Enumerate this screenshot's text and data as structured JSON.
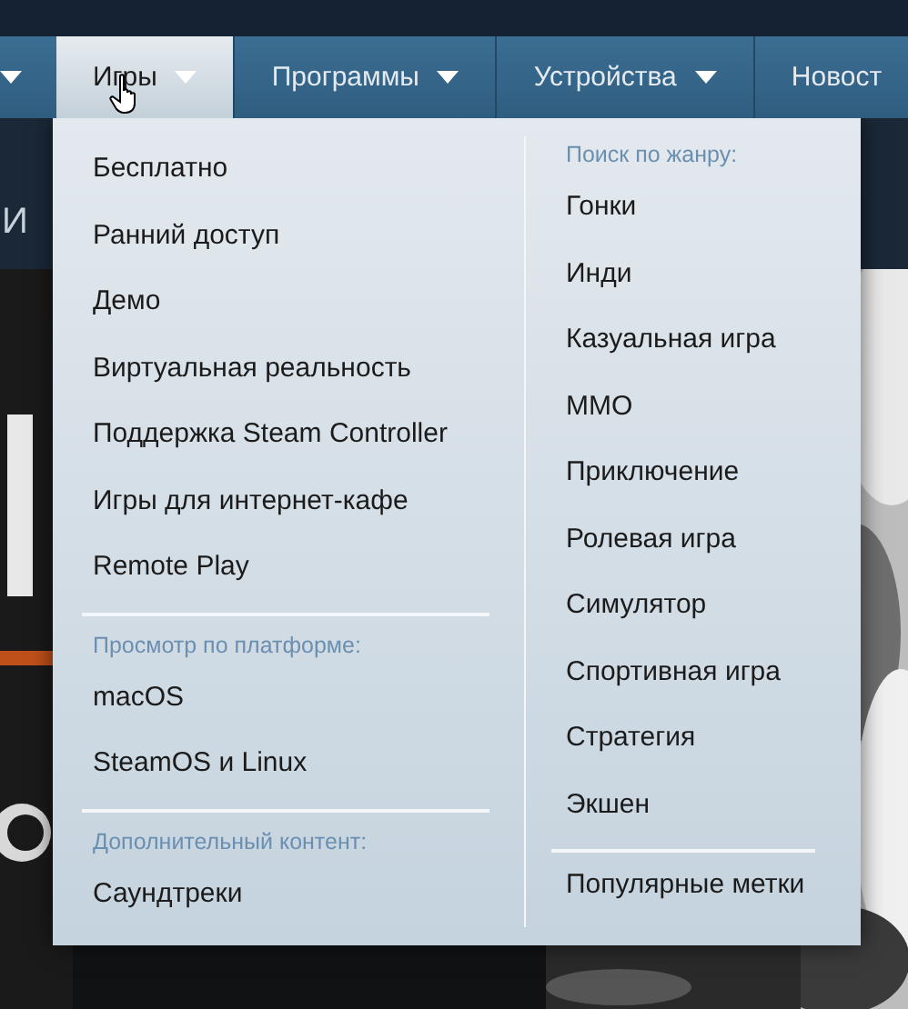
{
  "nav": {
    "items": [
      {
        "caret": true,
        "selected": false
      },
      {
        "label": "Игры",
        "caret": true,
        "selected": true
      },
      {
        "label": "Программы",
        "caret": true,
        "selected": false
      },
      {
        "label": "Устройства",
        "caret": true,
        "selected": false
      },
      {
        "label": "Новост",
        "caret": false,
        "selected": false
      }
    ]
  },
  "section_heading": "И",
  "menu": {
    "columns": [
      {
        "sections": [
          {
            "items": [
              "Бесплатно",
              "Ранний доступ",
              "Демо",
              "Виртуальная реальность",
              "Поддержка Steam Controller",
              "Игры для интернет-кафе",
              "Remote Play"
            ]
          },
          {
            "heading": "Просмотр по платформе:",
            "items": [
              "macOS",
              "SteamOS и Linux"
            ]
          },
          {
            "heading": "Дополнительный контент:",
            "items": [
              "Саундтреки"
            ]
          }
        ]
      },
      {
        "sections": [
          {
            "heading": "Поиск по жанру:",
            "items": [
              "Гонки",
              "Инди",
              "Казуальная игра",
              "MMO",
              "Приключение",
              "Ролевая игра",
              "Симулятор",
              "Спортивная игра",
              "Стратегия",
              "Экшен"
            ]
          },
          {
            "items": [
              "Популярные метки"
            ]
          }
        ]
      }
    ]
  }
}
